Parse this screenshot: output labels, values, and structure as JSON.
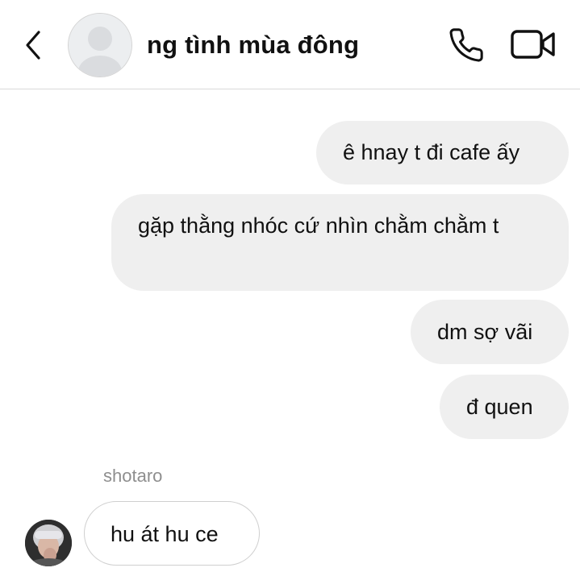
{
  "header": {
    "title": "ng tình mùa đông",
    "back_icon": "chevron-left-icon",
    "call_icon": "phone-icon",
    "video_icon": "video-camera-icon"
  },
  "messages": [
    {
      "direction": "outgoing",
      "text": "ê hnay t đi cafe ấy"
    },
    {
      "direction": "outgoing",
      "text": "gặp thằng nhóc cứ nhìn chằm chằm t"
    },
    {
      "direction": "outgoing",
      "text": "dm sợ vãi"
    },
    {
      "direction": "outgoing",
      "text": "đ quen"
    },
    {
      "direction": "incoming",
      "sender": "shotaro",
      "text": "hu át hu ce"
    }
  ],
  "colors": {
    "outgoing_bubble": "#efefef",
    "incoming_bubble_border": "#cfcfcf",
    "sender_name": "#8e8e8e",
    "divider": "#d9d9d9"
  }
}
